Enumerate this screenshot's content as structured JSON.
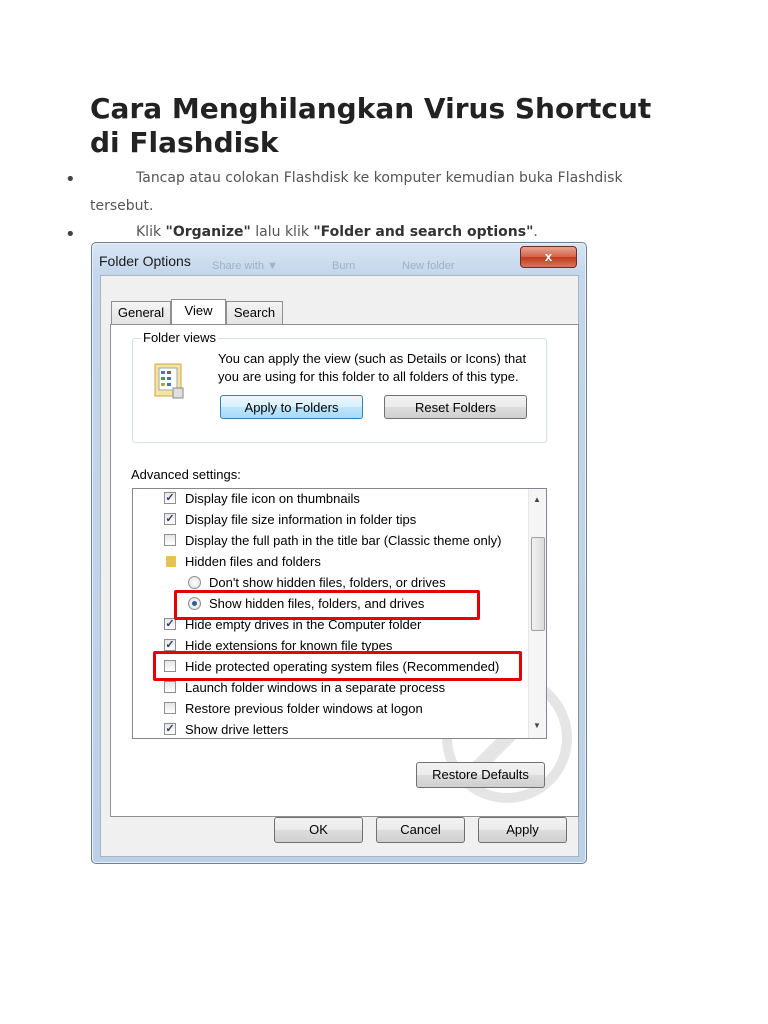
{
  "article": {
    "title_line1": "Cara Menghilangkan Virus Shortcut",
    "title_line2": "di Flashdisk",
    "bullet": "•",
    "step1": "Tancap atau colokan Flashdisk ke komputer kemudian buka Flashdisk",
    "step1_cont": "tersebut.",
    "step2_a": "Klik ",
    "step2_b": "\"Organize\"",
    "step2_c": " lalu klik ",
    "step2_d": "\"Folder and search options\"",
    "step2_e": "."
  },
  "dialog": {
    "title": "Folder Options",
    "close": "x",
    "ghost_toolbar": [
      "Share with ▼",
      "Burn",
      "New folder"
    ],
    "tabs": [
      "General",
      "View",
      "Search"
    ],
    "active_tab": "View",
    "folder_views": {
      "legend": "Folder views",
      "text": "You can apply the view (such as Details or Icons) that you are using for this folder to all folders of this type.",
      "apply_button": "Apply to Folders",
      "reset_button": "Reset Folders"
    },
    "advanced_label": "Advanced settings:",
    "settings": [
      {
        "type": "checkbox",
        "checked": true,
        "label": "Display file icon on thumbnails"
      },
      {
        "type": "checkbox",
        "checked": true,
        "label": "Display file size information in folder tips"
      },
      {
        "type": "checkbox",
        "checked": false,
        "label": "Display the full path in the title bar (Classic theme only)"
      },
      {
        "type": "folder",
        "label": "Hidden files and folders"
      },
      {
        "type": "radio",
        "checked": false,
        "label": "Don't show hidden files, folders, or drives"
      },
      {
        "type": "radio",
        "checked": true,
        "label": "Show hidden files, folders, and drives"
      },
      {
        "type": "checkbox",
        "checked": true,
        "label": "Hide empty drives in the Computer folder"
      },
      {
        "type": "checkbox",
        "checked": true,
        "label": "Hide extensions for known file types"
      },
      {
        "type": "checkbox",
        "checked": false,
        "label": "Hide protected operating system files (Recommended)"
      },
      {
        "type": "checkbox",
        "checked": false,
        "label": "Launch folder windows in a separate process"
      },
      {
        "type": "checkbox",
        "checked": false,
        "label": "Restore previous folder windows at logon"
      },
      {
        "type": "checkbox",
        "checked": true,
        "label": "Show drive letters"
      }
    ],
    "restore_defaults": "Restore Defaults",
    "ok": "OK",
    "cancel": "Cancel",
    "apply": "Apply"
  },
  "colors": {
    "highlight": "#e60000",
    "title_text": "#222222",
    "check": "#2c3e6b"
  }
}
